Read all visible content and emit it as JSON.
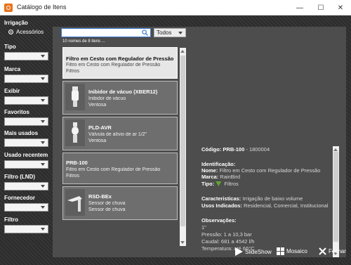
{
  "window": {
    "title": "Catálogo de Itens",
    "controls": {
      "minimize": "—",
      "maximize": "☐",
      "close": "✕"
    }
  },
  "sidebar": {
    "irrigacao_label": "Irrigação",
    "radio_label": "Acessórios",
    "filters": [
      {
        "label": "Tipo"
      },
      {
        "label": "Marca"
      },
      {
        "label": "Exibir"
      },
      {
        "label": "Favoritos"
      },
      {
        "label": "Mais usados"
      },
      {
        "label": "Usado recentem"
      },
      {
        "label": "Filtro (LND)"
      },
      {
        "label": "Fornecedor"
      },
      {
        "label": "Filtro"
      }
    ]
  },
  "search": {
    "value": "",
    "scope": "Todos",
    "count": "10 nomes de 8 itens ..."
  },
  "items": [
    {
      "title": "Filtro em Cesto com Regulador de Pressão",
      "lines": [
        "Filtro em Cesto com Regulador de Pressão",
        "Filtros"
      ],
      "selected": true,
      "thumb": "none"
    },
    {
      "title": "Inibidor de vácuo (XBER12)",
      "lines": [
        "Inibidor de vácuo",
        "Ventosa"
      ],
      "selected": false,
      "thumb": "valve-icon"
    },
    {
      "title": "PLD-AVR",
      "lines": [
        "Válvula de alívio de ar 1/2\"",
        "Ventosa"
      ],
      "selected": false,
      "thumb": "valve-icon"
    },
    {
      "title": "PRB-100",
      "lines": [
        "Filtro em Cesto com Regulador de Pressão",
        "Filtros"
      ],
      "selected": false,
      "thumb": "none"
    },
    {
      "title": "RSD-BEx",
      "lines": [
        "Sensor de chuva",
        "Sensor de chuva"
      ],
      "selected": false,
      "thumb": "sensor-icon"
    }
  ],
  "details": {
    "codigo_label": "Código:",
    "codigo_value": "PRB-100",
    "codigo_extra": "- 1800004",
    "identificacao_heading": "Identificação:",
    "nome_label": "Nome:",
    "nome_value": "Filtro em Cesto com Regulador de Pressão",
    "marca_label": "Marca:",
    "marca_value": "RainBird",
    "tipo_label": "Tipo:",
    "tipo_value": "Filtros",
    "caracteristicas_label": "Caracteristicas:",
    "caracteristicas_value": "Irrigação de baixo volume",
    "usos_label": "Usos Indicados:",
    "usos_value": "Residencial, Comercial, Institucional",
    "observacoes_heading": "Observações:",
    "obs_lines": [
      "1\"",
      "Pressão: 1 a 10,3 bar",
      "Caudal: 681 a 4542 l/h",
      "Temperatura: até 66°C"
    ]
  },
  "buttons": {
    "slideshow": "SlideShow",
    "mosaico": "Mosaico",
    "fechar": "Fechar"
  },
  "colors": {
    "accent": "#3a7bd5",
    "app_icon": "#e8731c",
    "badge": "#5fa82e"
  }
}
